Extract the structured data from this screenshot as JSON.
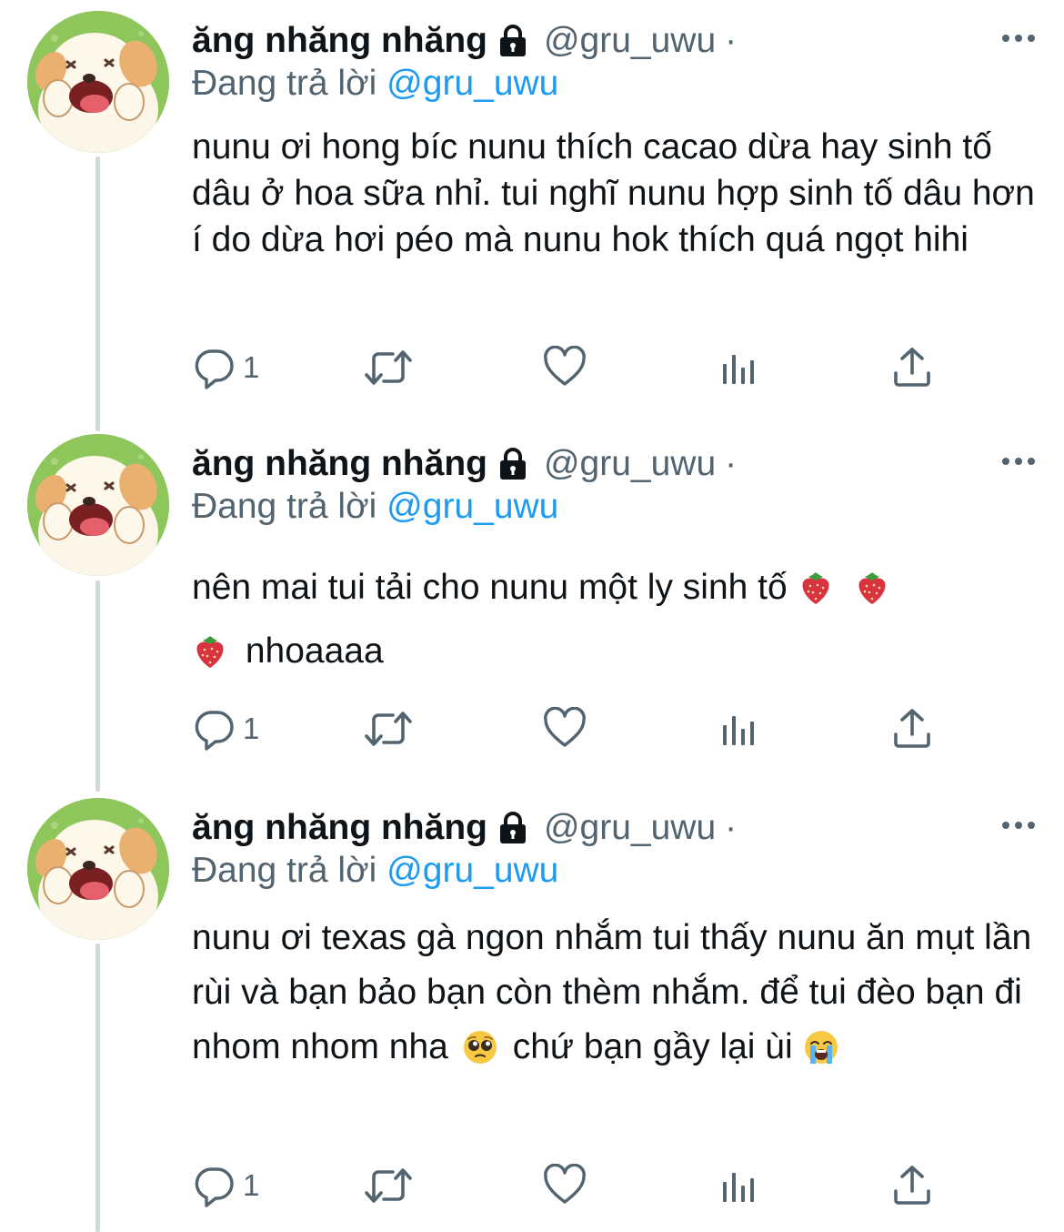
{
  "tweets": [
    {
      "name": "ăng nhăng nhăng",
      "handle": "@gru_uwu",
      "separator": "·",
      "reply_prefix": "Đang trả lời",
      "reply_mention": "@gru_uwu",
      "text": "nunu ơi hong bíc nunu thích cacao dừa hay sinh tố dâu ở hoa sữa nhỉ. tui nghĩ nunu hợp sinh tố dâu hơn í do dừa hơi péo mà nunu hok thích quá ngọt hihi",
      "reply_count": "1"
    },
    {
      "name": "ăng nhăng nhăng",
      "handle": "@gru_uwu",
      "separator": "·",
      "reply_prefix": "Đang trả lời",
      "reply_mention": "@gru_uwu",
      "text_line1": "nên mai tui tải cho nunu một ly sinh tố",
      "text_line2": "nhoaaaa",
      "reply_count": "1"
    },
    {
      "name": "ăng nhăng nhăng",
      "handle": "@gru_uwu",
      "separator": "·",
      "reply_prefix": "Đang trả lời",
      "reply_mention": "@gru_uwu",
      "text_part1": "nunu ơi texas gà ngon nhắm tui thấy nunu ăn mụt lần rùi và bạn bảo bạn còn thèm nhắm. để tui đèo bạn đi nhom nhom nha",
      "text_part2": "chứ bạn gầy lại ùi",
      "reply_count": "1"
    }
  ],
  "icons": {
    "lock": "lock-icon",
    "more": "more-icon",
    "reply": "reply-icon",
    "retweet": "retweet-icon",
    "like": "heart-icon",
    "views": "analytics-icon",
    "share": "share-icon",
    "strawberry": "strawberry-emoji",
    "pleading": "pleading-face-emoji",
    "crying": "loudly-crying-face-emoji"
  },
  "colors": {
    "text": "#0f1419",
    "secondary": "#536471",
    "link": "#1d9bf0",
    "thread_line": "#cfd9de"
  }
}
